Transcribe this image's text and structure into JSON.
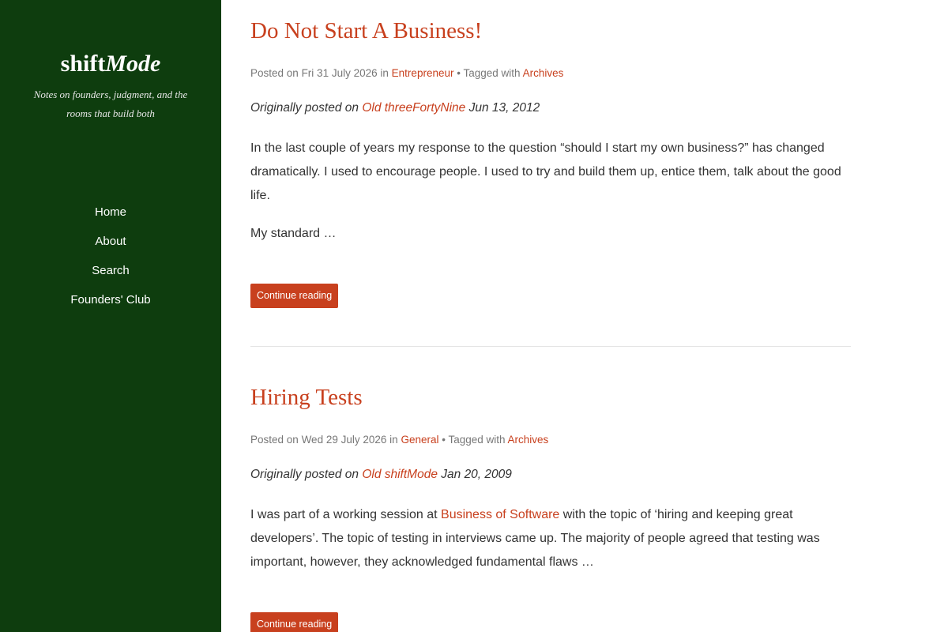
{
  "site": {
    "title_plain": "shift",
    "title_italic": "Mode",
    "tagline": "Notes on founders, judgment, and the rooms that build both"
  },
  "nav": {
    "items": [
      {
        "label": "Home"
      },
      {
        "label": "About"
      },
      {
        "label": "Search"
      },
      {
        "label": "Founders' Club"
      }
    ]
  },
  "posts": [
    {
      "title": "Do Not Start A Business!",
      "posted_prefix": "Posted on",
      "date": "Fri 31 July 2026",
      "in_word": "in",
      "category": "Entrepreneur",
      "tagged_text": "• Tagged with",
      "tag": "Archives",
      "orig_prefix": "Originally posted on",
      "orig_source": "Old threeFortyNine",
      "orig_date": "Jun 13, 2012",
      "paragraph": "In the last couple of years my response to the question “should I start my own business?” has changed dramatically. I used to encourage people. I used to try and build them up, entice them, talk about the good life.",
      "excerpt_end": "My standard …",
      "button": "Continue reading"
    },
    {
      "title": "Hiring Tests",
      "posted_prefix": "Posted on",
      "date": "Wed 29 July 2026",
      "in_word": "in",
      "category": "General",
      "tagged_text": "• Tagged with",
      "tag": "Archives",
      "orig_prefix": "Originally posted on",
      "orig_source": "Old shiftMode",
      "orig_date": "Jan 20, 2009",
      "para_before": "I was part of a working session at",
      "para_link": "Business of Software",
      "para_after": "with the topic of ‘hiring and keeping great developers’. The topic of testing in interviews came up. The majority of people agreed that testing was important, however, they acknowledged fundamental flaws …",
      "button": "Continue reading"
    }
  ],
  "colors": {
    "sidebar_bg": "#0e3d0e",
    "accent": "#c8401e",
    "meta_text": "#777777",
    "body_text": "#333333"
  }
}
